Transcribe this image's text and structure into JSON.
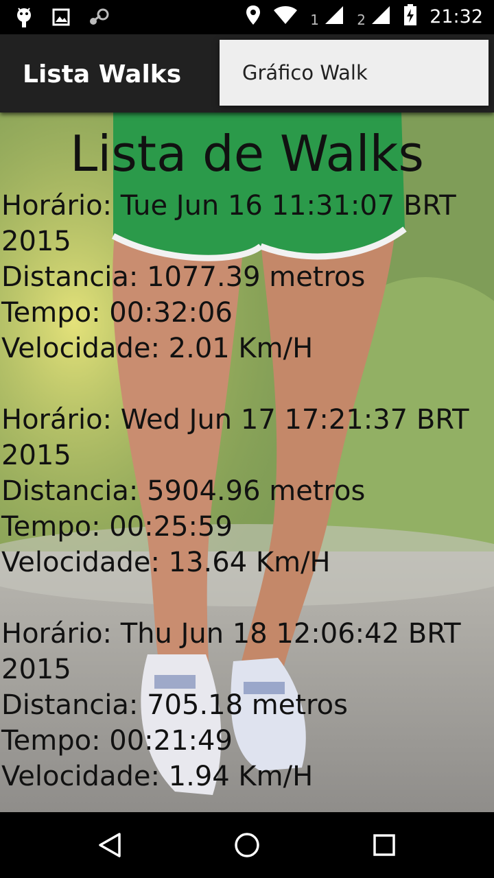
{
  "status_bar": {
    "time": "21:32",
    "sim1": "1",
    "sim2": "2",
    "icons": [
      "android-icon",
      "image-icon",
      "steam-icon",
      "location-icon",
      "wifi-icon",
      "battery-charging-icon"
    ]
  },
  "action_bar": {
    "title": "Lista Walks"
  },
  "overflow_menu": {
    "items": [
      {
        "label": "Gráfico Walk"
      }
    ]
  },
  "page": {
    "title": "Lista de Walks"
  },
  "walks": [
    {
      "horario": "Horário: Tue Jun 16 11:31:07 BRT 2015",
      "distancia": "Distancia: 1077.39 metros",
      "tempo": "Tempo: 00:32:06",
      "velocidade": "Velocidade: 2.01 Km/H"
    },
    {
      "horario": "Horário: Wed Jun 17 17:21:37 BRT 2015",
      "distancia": "Distancia: 5904.96 metros",
      "tempo": "Tempo: 00:25:59",
      "velocidade": "Velocidade: 13.64 Km/H"
    },
    {
      "horario": "Horário: Thu Jun 18 12:06:42 BRT 2015",
      "distancia": "Distancia: 705.18 metros",
      "tempo": "Tempo: 00:21:49",
      "velocidade": "Velocidade: 1.94 Km/H"
    }
  ],
  "nav_bar": {
    "buttons": [
      "back-icon",
      "home-icon",
      "recents-icon"
    ]
  }
}
